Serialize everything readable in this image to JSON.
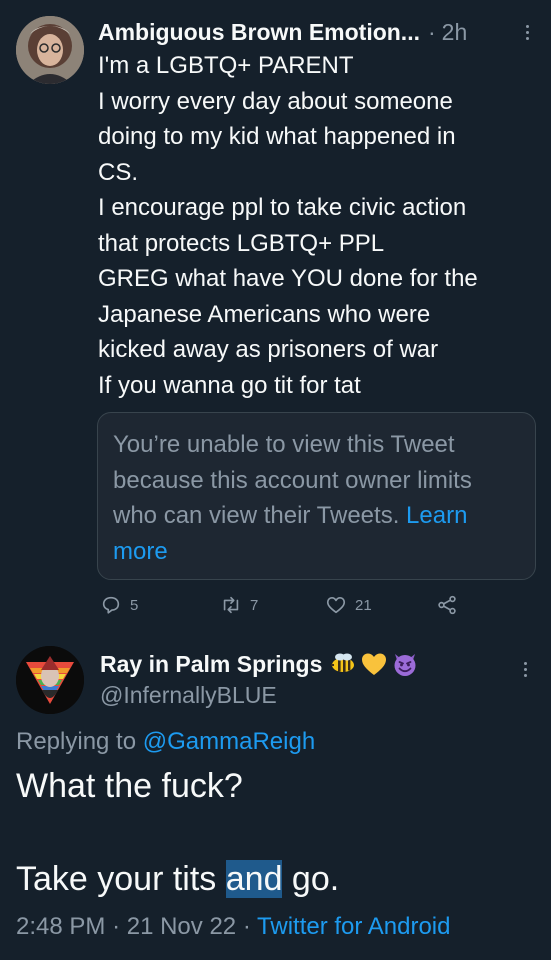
{
  "reply_tweet": {
    "display_name": "Ambiguous Brown Emotion...",
    "separator": "·",
    "time_ago": "2h",
    "lines": [
      "I'm a LGBTQ+ PARENT",
      "I worry every day about someone",
      "doing to my kid what happened in",
      "CS.",
      "I encourage ppl to take civic action",
      "that protects LGBTQ+ PPL",
      "GREG what have YOU done for the",
      "Japanese Americans who were",
      "kicked away as prisoners of war",
      "If you wanna go tit for tat"
    ],
    "quoted_unavailable": {
      "lines": [
        "You’re unable to view this Tweet",
        "because this account owner limits",
        "who can view their Tweets."
      ],
      "link_part1": "Learn",
      "link_part2": "more"
    },
    "actions": {
      "reply_count": "5",
      "retweet_count": "7",
      "like_count": "21"
    }
  },
  "main_tweet": {
    "display_name": "Ray in Palm Springs",
    "emojis": [
      "bee-emoji",
      "yellow-heart-emoji",
      "smiling-devil-emoji"
    ],
    "handle": "@InfernallyBLUE",
    "replying_prefix": "Replying to",
    "replying_mention": "@GammaReigh",
    "body_line1": "What the fuck?",
    "body_line2_before": "Take your tits ",
    "body_line2_highlight": "and",
    "body_line2_after": " go.",
    "time": "2:48 PM",
    "date": "21 Nov 22",
    "source": "Twitter for Android",
    "meta_sep": "·"
  },
  "colors": {
    "background": "#15202b",
    "text": "#f7f9f9",
    "secondary": "#8b98a5",
    "link": "#1d9bf0",
    "highlight": "#1f5a8c"
  }
}
